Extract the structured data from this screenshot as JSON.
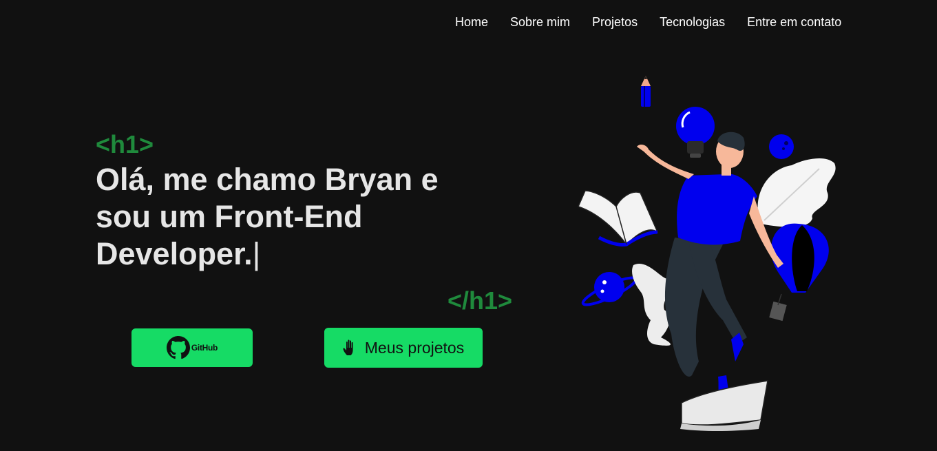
{
  "nav": {
    "items": [
      {
        "label": "Home"
      },
      {
        "label": "Sobre mim"
      },
      {
        "label": "Projetos"
      },
      {
        "label": "Tecnologias"
      },
      {
        "label": "Entre em contato"
      }
    ]
  },
  "hero": {
    "tag_open": "<h1>",
    "headline": "Olá, me chamo Bryan e sou um Front-End Developer.",
    "cursor": "|",
    "tag_close": "</h1>"
  },
  "buttons": {
    "github_label": "GitHub",
    "projects_label": "Meus projetos",
    "github_icon": "github-icon",
    "projects_icon": "waving-hand-icon"
  },
  "colors": {
    "background": "#111111",
    "accent_green": "#16db65",
    "tag_green": "#1f8a3c",
    "illustration_blue": "#0000ee"
  }
}
